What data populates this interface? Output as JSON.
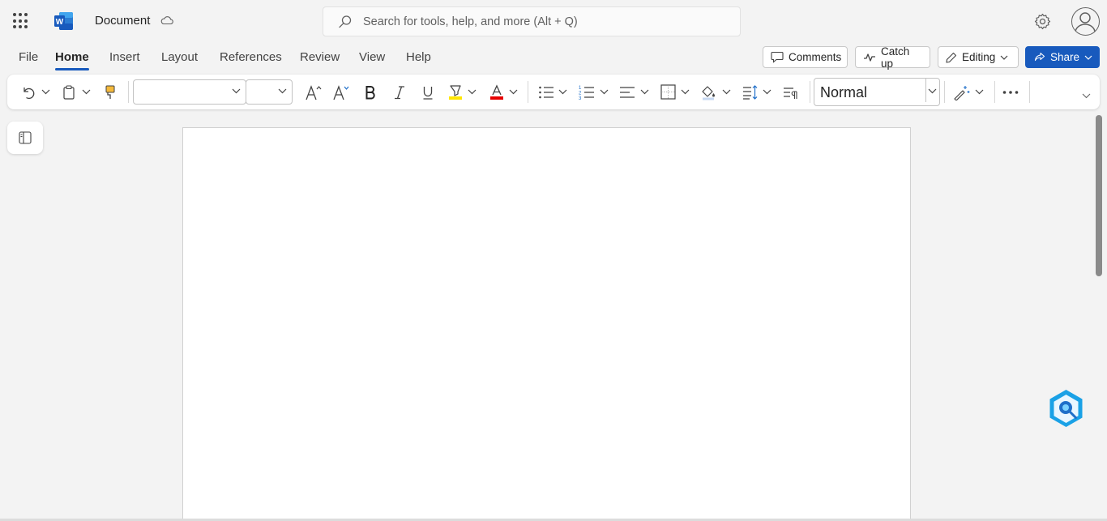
{
  "header": {
    "app_name": "Word",
    "doc_title": "Document",
    "search_placeholder": "Search for tools, help, and more (Alt + Q)"
  },
  "tabs": [
    {
      "label": "File"
    },
    {
      "label": "Home"
    },
    {
      "label": "Insert"
    },
    {
      "label": "Layout"
    },
    {
      "label": "References"
    },
    {
      "label": "Review"
    },
    {
      "label": "View"
    },
    {
      "label": "Help"
    }
  ],
  "actions": {
    "comments": "Comments",
    "catch_up": "Catch up",
    "editing": "Editing",
    "share": "Share"
  },
  "toolbar": {
    "font_name": "",
    "font_size": "",
    "style": "Normal"
  },
  "colors": {
    "accent": "#185abd",
    "font_color_bar": "#e60000",
    "highlight_bar": "#ffe600"
  }
}
